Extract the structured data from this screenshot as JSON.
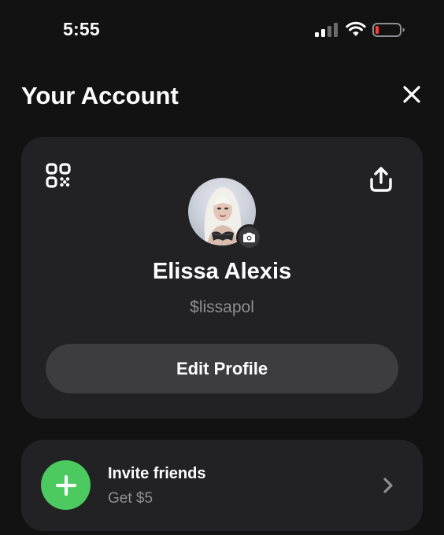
{
  "status_bar": {
    "time": "5:55",
    "signal_icon": "cellular-signal-icon",
    "wifi_icon": "wifi-icon",
    "battery_icon": "battery-low-icon",
    "battery_level_color": "#ff3b30"
  },
  "header": {
    "title": "Your Account",
    "close_icon": "close-icon"
  },
  "profile": {
    "name": "Elissa Alexis",
    "cashtag": "$lissapol",
    "edit_label": "Edit Profile",
    "qr_icon": "qr-code-icon",
    "share_icon": "share-icon",
    "camera_icon": "camera-icon"
  },
  "invite": {
    "title": "Invite friends",
    "subtitle": "Get $5",
    "plus_icon": "plus-icon",
    "chevron_icon": "chevron-right-icon",
    "accent_color": "#4cc95f"
  },
  "colors": {
    "background": "#121212",
    "card": "#222224",
    "button": "#3d3d40",
    "secondary_text": "#8e8e93"
  }
}
